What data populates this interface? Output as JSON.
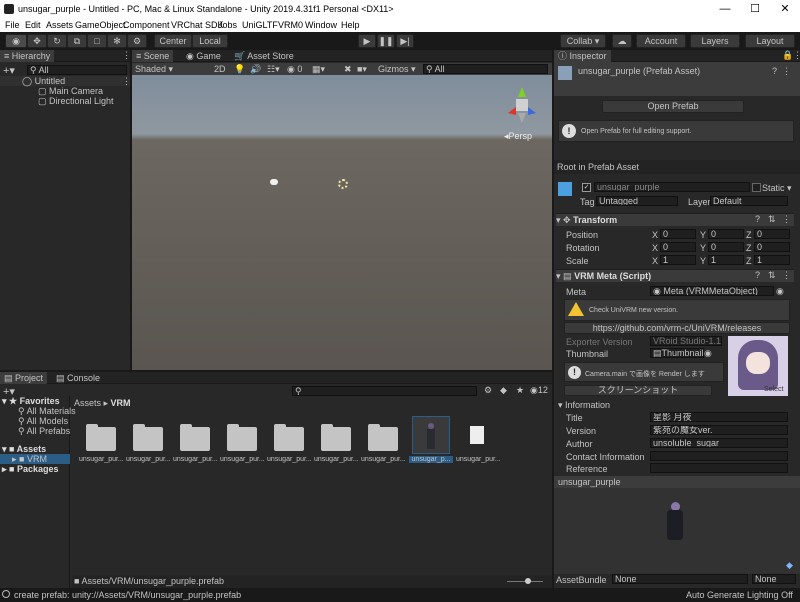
{
  "window": {
    "title": "unsugar_purple - Untitled - PC, Mac & Linux Standalone - Unity 2019.4.31f1 Personal <DX11>",
    "minimize": "—",
    "maximize": "☐",
    "close": "✕"
  },
  "menu": [
    "File",
    "Edit",
    "Assets",
    "GameObject",
    "Component",
    "VRChat SDK",
    "Jobs",
    "UniGLTF",
    "VRM0",
    "Window",
    "Help"
  ],
  "toolbar": {
    "center_label": "Center",
    "local_label": "Local",
    "collab_label": "Collab ▾",
    "account_label": "Account",
    "layers_label": "Layers",
    "layout_label": "Layout"
  },
  "hierarchy": {
    "tab": "Hierarchy",
    "search_placeholder": "All",
    "scene_name": "Untitled",
    "items": [
      "Main Camera",
      "Directional Light"
    ]
  },
  "scene": {
    "tabs": [
      "Scene",
      "Game",
      "Asset Store"
    ],
    "shading": "Shaded",
    "mode_2d": "2D",
    "fx_count": "0",
    "gizmos": "Gizmos",
    "search_placeholder": "All",
    "persp": "◂Persp"
  },
  "project": {
    "tabs": [
      "Project",
      "Console"
    ],
    "hidden_count": "12",
    "favorites_label": "Favorites",
    "favorites": [
      "All Materials",
      "All Models",
      "All Prefabs"
    ],
    "assets_label": "Assets",
    "vrm_label": "VRM",
    "packages_label": "Packages",
    "breadcrumb_assets": "Assets",
    "breadcrumb_vrm": "VRM",
    "asset_items": [
      "unsugar_pur...",
      "unsugar_pur...",
      "unsugar_pur...",
      "unsugar_pur...",
      "unsugar_pur...",
      "unsugar_pur...",
      "unsugar_pur...",
      "unsugar_p...",
      "unsugar_pur..."
    ],
    "footer_path": "Assets/VRM/unsugar_purple.prefab"
  },
  "inspector": {
    "tab": "Inspector",
    "asset_title": "unsugar_purple (Prefab Asset)",
    "open_prefab": "Open Prefab",
    "open_prefab_help": "Open Prefab for full editing support.",
    "root_label": "Root in Prefab Asset",
    "object_name": "unsugar_purple",
    "static_label": "Static",
    "tag_label": "Tag",
    "tag_value": "Untagged",
    "layer_label": "Layer",
    "layer_value": "Default",
    "transform": {
      "title": "Transform",
      "rows": [
        {
          "label": "Position",
          "x": "0",
          "y": "0",
          "z": "0"
        },
        {
          "label": "Rotation",
          "x": "0",
          "y": "0",
          "z": "0"
        },
        {
          "label": "Scale",
          "x": "1",
          "y": "1",
          "z": "1"
        }
      ],
      "x_label": "X",
      "y_label": "Y",
      "z_label": "Z"
    },
    "vrm_meta": {
      "title": "VRM Meta (Script)",
      "meta_label": "Meta",
      "meta_value": "Meta (VRMMetaObject)",
      "check_text": "Check UniVRM new version.",
      "url_button": "https://github.com/vrm-c/UniVRM/releases",
      "exporter_label": "Exporter Version",
      "exporter_value": "VRoid Studio-1.1",
      "thumbnail_label": "Thumbnail",
      "thumbnail_value": "Thumbnail",
      "render_text": "Camera.main で画像を Render します",
      "screenshot_button": "スクリーンショット",
      "select_label": "Select"
    },
    "information": {
      "title": "Information",
      "rows": [
        {
          "label": "Title",
          "value": "星影 月夜"
        },
        {
          "label": "Version",
          "value": "紫苑の魔女ver."
        },
        {
          "label": "Author",
          "value": "unsoluble_sugar"
        },
        {
          "label": "Contact Information",
          "value": ""
        },
        {
          "label": "Reference",
          "value": ""
        }
      ]
    },
    "preview_title": "unsugar_purple",
    "assetbundle_label": "AssetBundle",
    "assetbundle_value": "None",
    "assetbundle_variant": "None"
  },
  "status": {
    "message": "create prefab: unity://Assets/VRM/unsugar_purple.prefab",
    "lighting": "Auto Generate Lighting Off"
  },
  "colors": {
    "accent": "#2c5d87",
    "panel": "#282828",
    "sky": "#6f8092",
    "ground": "#5f5a55"
  }
}
